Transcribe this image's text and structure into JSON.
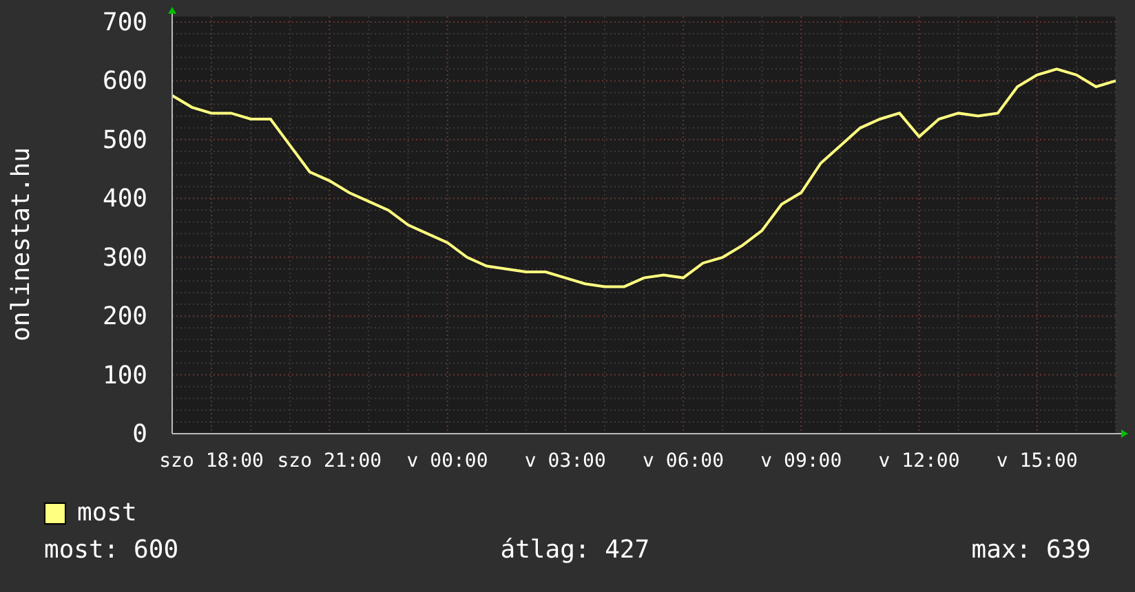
{
  "chart": {
    "y_title": "onlinestat.hu",
    "chart_data": {
      "type": "line",
      "grid": true,
      "ylim": [
        0,
        700
      ],
      "yticks": [
        0,
        100,
        200,
        300,
        400,
        500,
        600,
        700
      ],
      "categories": [
        null,
        null,
        "szo 18:00",
        null,
        null,
        null,
        null,
        null,
        "szo 21:00",
        null,
        null,
        null,
        null,
        null,
        "v 00:00",
        null,
        null,
        null,
        null,
        null,
        "v 03:00",
        null,
        null,
        null,
        null,
        null,
        "v 06:00",
        null,
        null,
        null,
        null,
        null,
        "v 09:00",
        null,
        null,
        null,
        null,
        null,
        "v 12:00",
        null,
        null,
        null,
        null,
        null,
        "v 15:00",
        null,
        null,
        null,
        null
      ],
      "series": [
        {
          "name": "most",
          "color": "#ffff80",
          "values": [
            575,
            555,
            545,
            545,
            535,
            535,
            490,
            445,
            430,
            410,
            395,
            380,
            355,
            340,
            325,
            300,
            285,
            280,
            275,
            275,
            265,
            255,
            250,
            250,
            265,
            270,
            265,
            290,
            300,
            320,
            345,
            390,
            410,
            460,
            490,
            520,
            535,
            545,
            505,
            535,
            545,
            540,
            545,
            590,
            610,
            620,
            610,
            590,
            600
          ]
        }
      ]
    }
  },
  "stats": [
    "most: 600",
    "átlag: 427",
    "max: 639"
  ]
}
